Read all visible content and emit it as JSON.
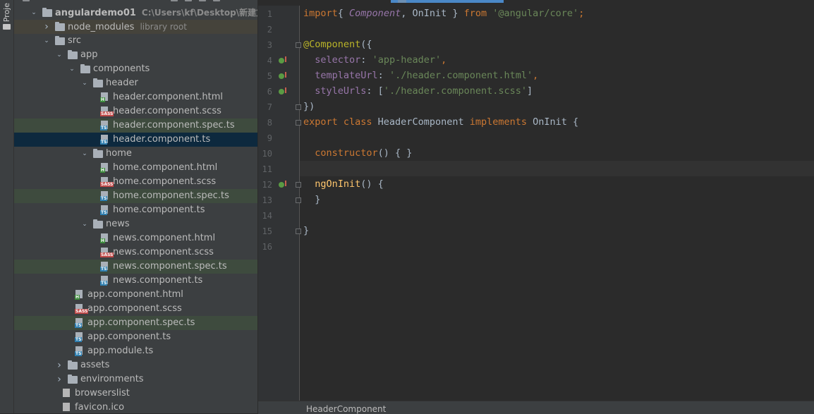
{
  "project_panel": {
    "tab_label": "Proje",
    "tree": [
      {
        "id": "r0",
        "label": "angulardemo01",
        "hint": "C:\\Users\\kf\\Desktop\\新建文件夹\\da",
        "type": "folder",
        "depth": 0,
        "open": true,
        "bold": true
      },
      {
        "id": "r1",
        "label": "node_modules",
        "hint": "library root",
        "type": "folder",
        "depth": 1,
        "open": false,
        "state": "lib"
      },
      {
        "id": "r2",
        "label": "src",
        "type": "folder",
        "depth": 1,
        "open": true
      },
      {
        "id": "r3",
        "label": "app",
        "type": "folder",
        "depth": 2,
        "open": true
      },
      {
        "id": "r4",
        "label": "components",
        "type": "folder",
        "depth": 3,
        "open": true
      },
      {
        "id": "r5",
        "label": "header",
        "type": "folder",
        "depth": 4,
        "open": true
      },
      {
        "id": "r6",
        "label": "header.component.html",
        "type": "html",
        "depth": 5
      },
      {
        "id": "r7",
        "label": "header.component.scss",
        "type": "scss",
        "depth": 5
      },
      {
        "id": "r8",
        "label": "header.component.spec.ts",
        "type": "ts",
        "depth": 5,
        "state": "hl"
      },
      {
        "id": "r9",
        "label": "header.component.ts",
        "type": "ts",
        "depth": 5,
        "state": "sel"
      },
      {
        "id": "r10",
        "label": "home",
        "type": "folder",
        "depth": 4,
        "open": true
      },
      {
        "id": "r11",
        "label": "home.component.html",
        "type": "html",
        "depth": 5
      },
      {
        "id": "r12",
        "label": "home.component.scss",
        "type": "scss",
        "depth": 5
      },
      {
        "id": "r13",
        "label": "home.component.spec.ts",
        "type": "ts",
        "depth": 5,
        "state": "hl"
      },
      {
        "id": "r14",
        "label": "home.component.ts",
        "type": "ts",
        "depth": 5
      },
      {
        "id": "r15",
        "label": "news",
        "type": "folder",
        "depth": 4,
        "open": true
      },
      {
        "id": "r16",
        "label": "news.component.html",
        "type": "html",
        "depth": 5
      },
      {
        "id": "r17",
        "label": "news.component.scss",
        "type": "scss",
        "depth": 5
      },
      {
        "id": "r18",
        "label": "news.component.spec.ts",
        "type": "ts",
        "depth": 5,
        "state": "hl"
      },
      {
        "id": "r19",
        "label": "news.component.ts",
        "type": "ts",
        "depth": 5
      },
      {
        "id": "r20",
        "label": "app.component.html",
        "type": "html",
        "depth": 3
      },
      {
        "id": "r21",
        "label": "app.component.scss",
        "type": "scss",
        "depth": 3
      },
      {
        "id": "r22",
        "label": "app.component.spec.ts",
        "type": "ts",
        "depth": 3,
        "state": "hl"
      },
      {
        "id": "r23",
        "label": "app.component.ts",
        "type": "ts",
        "depth": 3
      },
      {
        "id": "r24",
        "label": "app.module.ts",
        "type": "ts",
        "depth": 3
      },
      {
        "id": "r25",
        "label": "assets",
        "type": "folder",
        "depth": 2,
        "open": false
      },
      {
        "id": "r26",
        "label": "environments",
        "type": "folder",
        "depth": 2,
        "open": false
      },
      {
        "id": "r27",
        "label": "browserslist",
        "type": "plain",
        "depth": 2
      },
      {
        "id": "r28",
        "label": "favicon.ico",
        "type": "plain",
        "depth": 2
      }
    ],
    "badges": {
      "html": "H",
      "scss": "SASS",
      "ts": "TS"
    }
  },
  "editor": {
    "current_line": 11,
    "lines": [
      {
        "n": "1",
        "tokens": [
          [
            "kw",
            "import"
          ],
          [
            "",
            "{ "
          ],
          [
            "cls",
            "Component"
          ],
          [
            "",
            ", OnInit } "
          ],
          [
            "kw",
            "from"
          ],
          [
            "",
            " "
          ],
          [
            "str",
            "'@angular/core'"
          ],
          [
            "kw",
            ";"
          ]
        ]
      },
      {
        "n": "2",
        "tokens": []
      },
      {
        "n": "3",
        "fold": true,
        "tokens": [
          [
            "ann",
            "@Component"
          ],
          [
            "",
            "({"
          ]
        ]
      },
      {
        "n": "4",
        "mark": true,
        "tokens": [
          [
            "",
            "  "
          ],
          [
            "attr",
            "selector"
          ],
          [
            "",
            ": "
          ],
          [
            "str",
            "'app-header'"
          ],
          [
            "kw",
            ","
          ]
        ]
      },
      {
        "n": "5",
        "mark": true,
        "tokens": [
          [
            "",
            "  "
          ],
          [
            "attr",
            "templateUrl"
          ],
          [
            "",
            ": "
          ],
          [
            "str",
            "'./header.component.html'"
          ],
          [
            "kw",
            ","
          ]
        ]
      },
      {
        "n": "6",
        "mark": true,
        "tokens": [
          [
            "",
            "  "
          ],
          [
            "attr",
            "styleUrls"
          ],
          [
            "",
            ": ["
          ],
          [
            "str",
            "'./header.component.scss'"
          ],
          [
            "",
            "]"
          ]
        ]
      },
      {
        "n": "7",
        "fold": true,
        "tokens": [
          [
            "",
            "})"
          ]
        ]
      },
      {
        "n": "8",
        "fold": true,
        "tokens": [
          [
            "kw",
            "export class "
          ],
          [
            "",
            "HeaderComponent "
          ],
          [
            "kw",
            "implements "
          ],
          [
            "",
            "OnInit {"
          ]
        ]
      },
      {
        "n": "9",
        "tokens": []
      },
      {
        "n": "10",
        "tokens": [
          [
            "",
            "  "
          ],
          [
            "kw",
            "constructor"
          ],
          [
            "",
            "() { }"
          ]
        ]
      },
      {
        "n": "11",
        "tokens": []
      },
      {
        "n": "12",
        "mark": true,
        "fold": true,
        "tokens": [
          [
            "",
            "  "
          ],
          [
            "fn",
            "ngOnInit"
          ],
          [
            "",
            "() {"
          ]
        ]
      },
      {
        "n": "13",
        "fold": true,
        "tokens": [
          [
            "",
            "  }"
          ]
        ]
      },
      {
        "n": "14",
        "tokens": []
      },
      {
        "n": "15",
        "fold": true,
        "tokens": [
          [
            "",
            "}"
          ]
        ]
      },
      {
        "n": "16",
        "tokens": []
      }
    ]
  },
  "breadcrumb": {
    "label": "HeaderComponent"
  }
}
